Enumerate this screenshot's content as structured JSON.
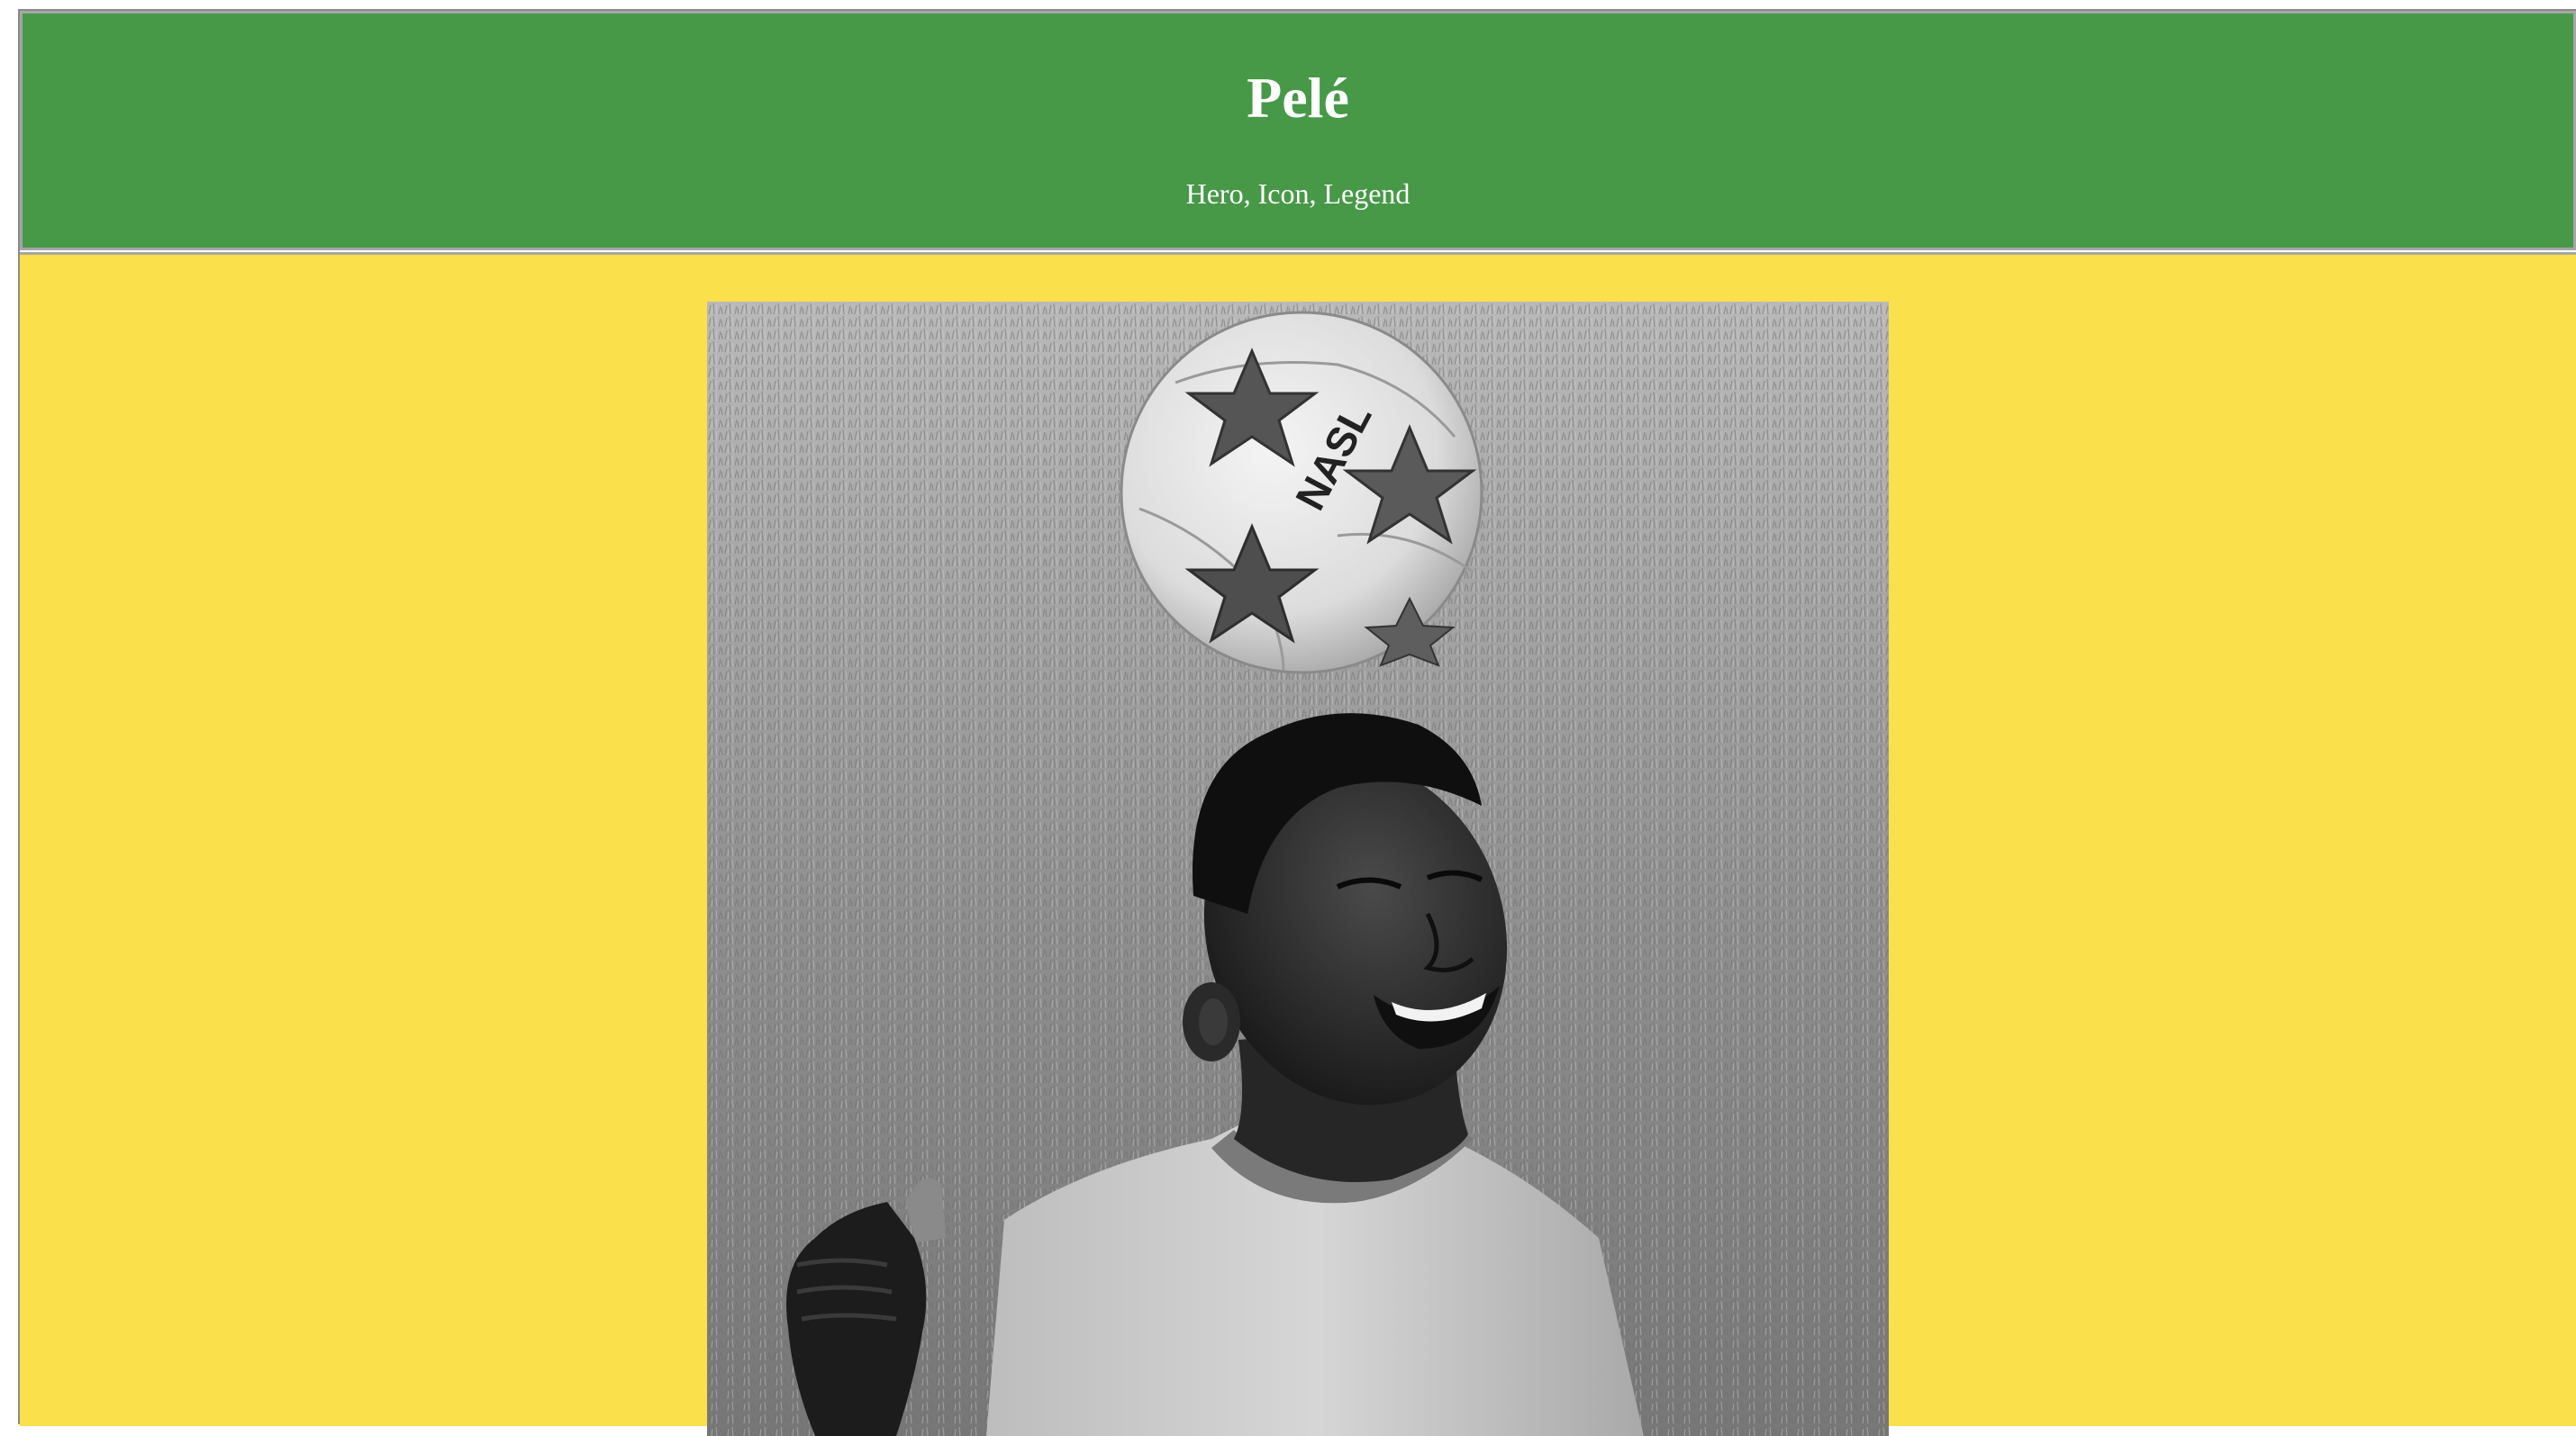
{
  "header": {
    "title": "Pelé",
    "subtitle": "Hero, Icon, Legend",
    "background_color": "#479948"
  },
  "main": {
    "background_color": "#fae04a",
    "photo": {
      "ball_text": "NASL",
      "style": "black-and-white photograph"
    }
  }
}
